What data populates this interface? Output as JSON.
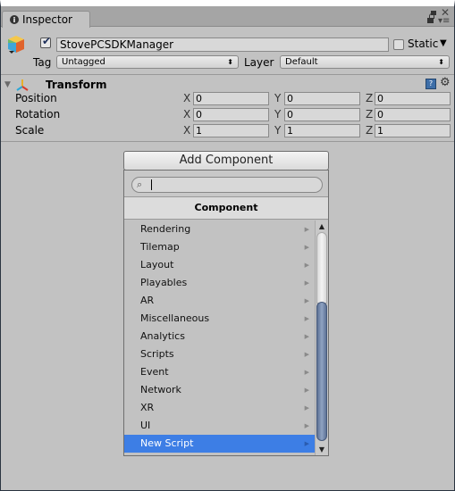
{
  "window": {
    "tab_label": "Inspector"
  },
  "gameobject": {
    "active": true,
    "name": "StovePCSDKManager",
    "static_label": "Static",
    "static_checked": false,
    "tag_label": "Tag",
    "tag_value": "Untagged",
    "layer_label": "Layer",
    "layer_value": "Default"
  },
  "transform": {
    "title": "Transform",
    "rows": [
      {
        "label": "Position",
        "x": "0",
        "y": "0",
        "z": "0"
      },
      {
        "label": "Rotation",
        "x": "0",
        "y": "0",
        "z": "0"
      },
      {
        "label": "Scale",
        "x": "1",
        "y": "1",
        "z": "1"
      }
    ],
    "axis": {
      "x": "X",
      "y": "Y",
      "z": "Z"
    }
  },
  "add_component": {
    "button_label": "Add Component",
    "search_value": "",
    "header": "Component",
    "items": [
      "Rendering",
      "Tilemap",
      "Layout",
      "Playables",
      "AR",
      "Miscellaneous",
      "Analytics",
      "Scripts",
      "Event",
      "Network",
      "XR",
      "UI",
      "New Script"
    ],
    "selected_index": 12
  },
  "icons": {
    "info": "info-icon",
    "maximize": "maximize-icon",
    "close": "close-icon",
    "lock": "lock-icon",
    "menu": "menu-icon",
    "gameobject": "cube-icon",
    "transform": "transform-axes-icon",
    "help": "help-book-icon",
    "settings": "gear-icon",
    "search": "search-icon"
  },
  "colors": {
    "selection": "#3d7ee5",
    "panel": "#c2c2c2",
    "scroll_thumb": "#7a8db0"
  }
}
